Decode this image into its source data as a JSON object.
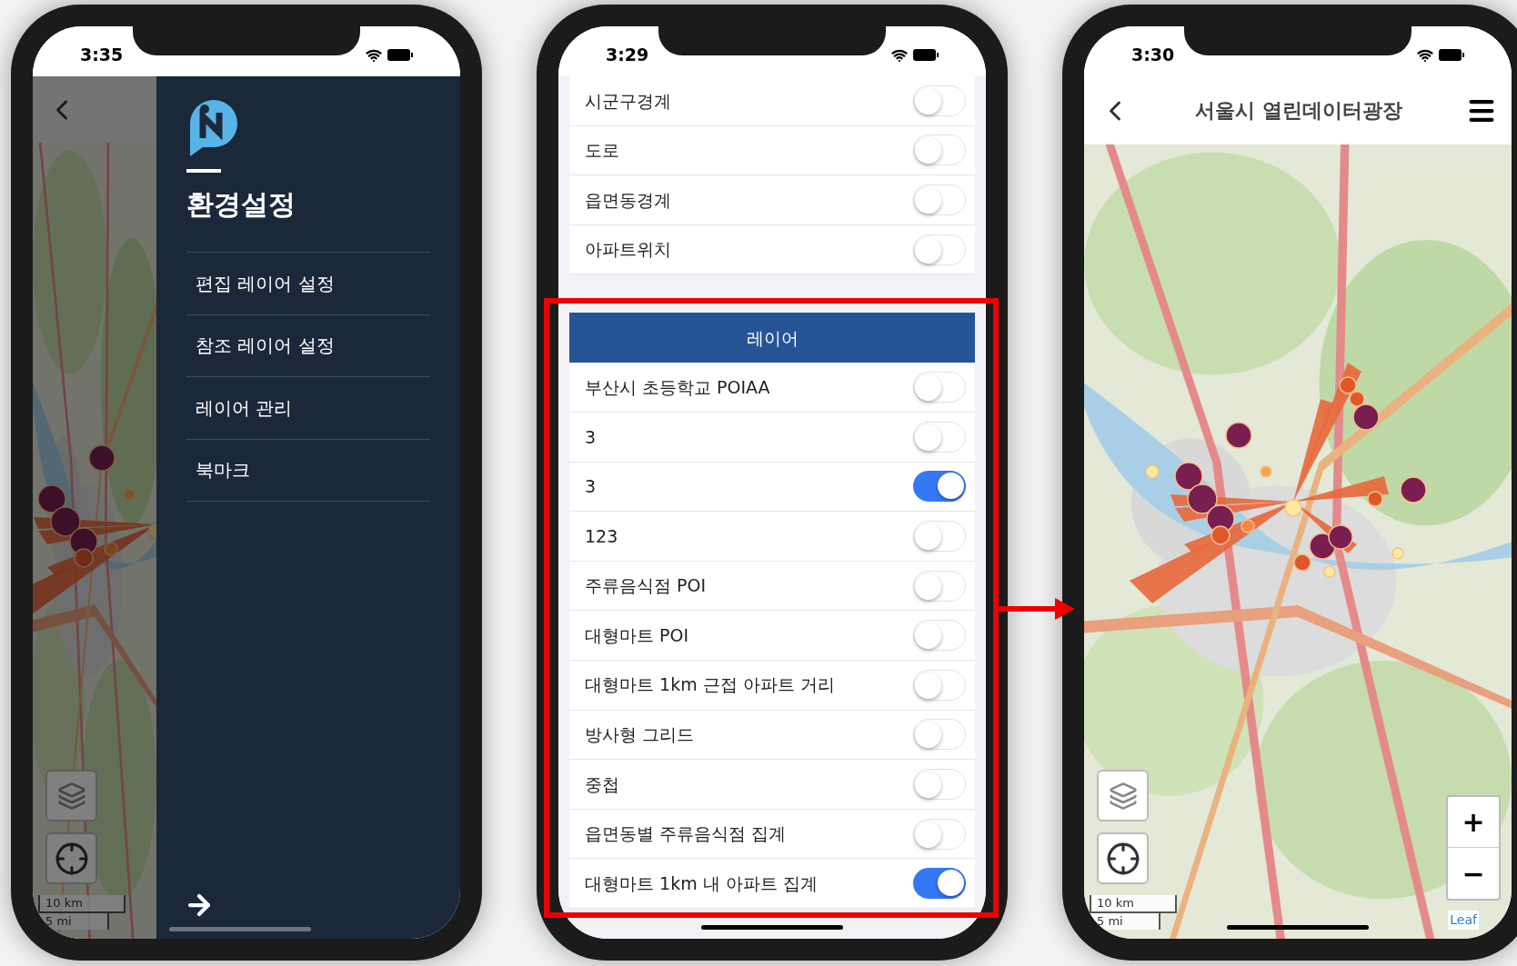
{
  "drawer_screen": {
    "time": "3:35",
    "drawer_title": "환경설정",
    "menu_items": [
      {
        "label": "편집 레이어 설정"
      },
      {
        "label": "참조 레이어 설정"
      },
      {
        "label": "레이어 관리"
      },
      {
        "label": "북마크"
      }
    ],
    "scale_km": "10 km",
    "scale_mi": "5 mi"
  },
  "layers_screen": {
    "time": "3:29",
    "base_layers": [
      {
        "label": "시군구경계",
        "on": false
      },
      {
        "label": "도로",
        "on": false
      },
      {
        "label": "읍면동경계",
        "on": false
      },
      {
        "label": "아파트위치",
        "on": false
      }
    ],
    "section_title": "레이어",
    "layers": [
      {
        "label": "부산시 초등학교 POIAA",
        "on": false
      },
      {
        "label": "3",
        "on": false
      },
      {
        "label": "3",
        "on": true
      },
      {
        "label": "123",
        "on": false
      },
      {
        "label": "주류음식점 POI",
        "on": false
      },
      {
        "label": "대형마트 POI",
        "on": false
      },
      {
        "label": "대형마트 1km 근접 아파트 거리",
        "on": false
      },
      {
        "label": "방사형 그리드",
        "on": false
      },
      {
        "label": "중첩",
        "on": false
      },
      {
        "label": "읍면동별 주류음식점 집계",
        "on": false
      },
      {
        "label": "대형마트 1km 내 아파트 집계",
        "on": true
      }
    ]
  },
  "map_screen": {
    "time": "3:30",
    "title": "서울시 열린데이터광장",
    "zoom_in": "+",
    "zoom_out": "−",
    "scale_km": "10 km",
    "scale_mi": "5 mi",
    "attribution": "Leaf"
  }
}
